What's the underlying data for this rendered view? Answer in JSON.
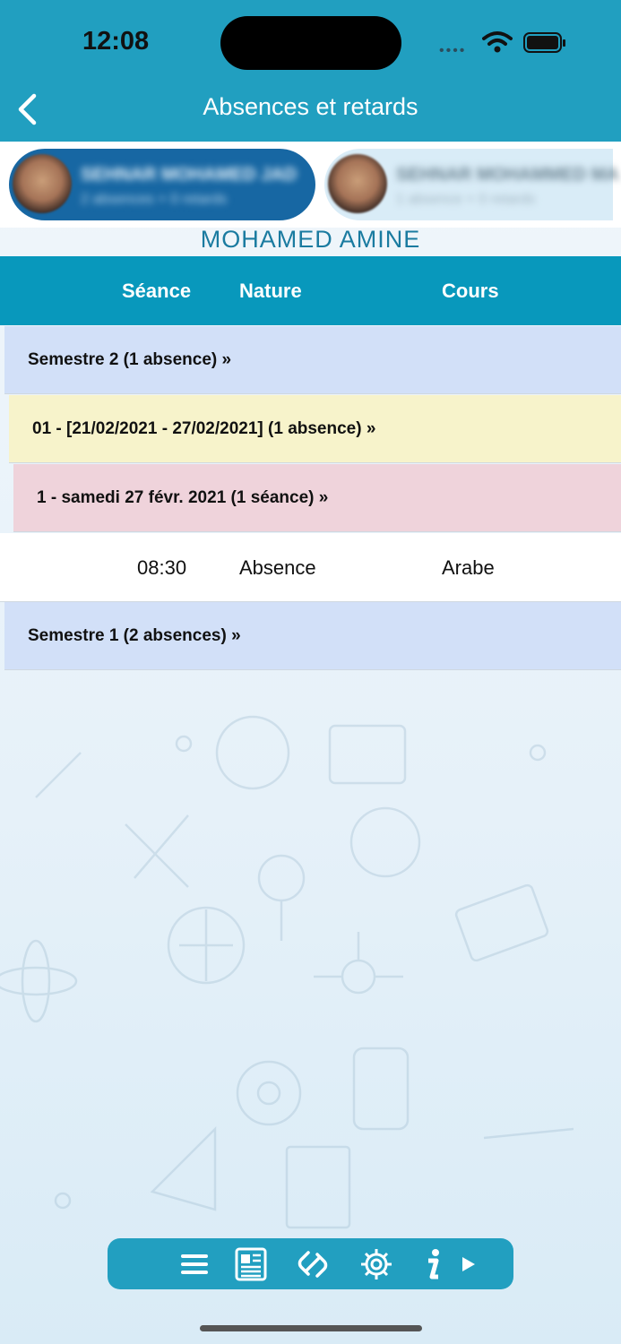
{
  "status_bar": {
    "time": "12:08"
  },
  "header": {
    "title": "Absences et retards"
  },
  "students": [
    {
      "name": "SEHNAR MOHAMED JAD",
      "summary": "2 absences + 0 retards",
      "selected": true
    },
    {
      "name": "SEHNAR MOHAMMED MA",
      "summary": "1 absence + 0 retards",
      "selected": false
    }
  ],
  "current_student": "MOHAMED AMINE",
  "table": {
    "columns": [
      "Séance",
      "Nature",
      "Cours"
    ],
    "semester2": "Semestre 2  (1 absence) »",
    "week": "01 - [21/02/2021 - 27/02/2021] (1 absence) »",
    "day": "1 - samedi 27 févr. 2021 (1 séance) »",
    "entry": {
      "time": "08:30",
      "nature": "Absence",
      "course": "Arabe"
    },
    "semester1": "Semestre 1  (2 absences) »"
  },
  "toolbar": {
    "icons": [
      "menu-icon",
      "news-icon",
      "link-icon",
      "settings-icon",
      "info-icon",
      "play-icon"
    ]
  },
  "colors": {
    "header": "#219fc0",
    "table_header": "#0898bc",
    "semester_row": "#d2e0f8",
    "week_row": "#f7f3cb",
    "day_row": "#efd3db",
    "student_name": "#1a7ba0"
  }
}
